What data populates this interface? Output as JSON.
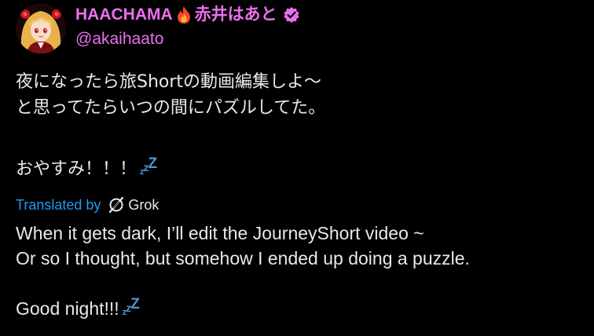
{
  "author": {
    "display_name_prefix": "HAACHAMA",
    "display_name_suffix": "赤井はあと",
    "handle": "@akaihaato",
    "name_color": "#eb6ff0",
    "icons": [
      "avatar",
      "fire-icon",
      "verified-badge-icon"
    ]
  },
  "post": {
    "lines": [
      "夜になったら旅Shortの動画編集しよ～",
      "と思ってたらいつの間にパズルしてた。"
    ],
    "closing": "おやすみ！！！",
    "sleep_emoji": "zzZ"
  },
  "translation": {
    "label": "Translated by",
    "provider": "Grok",
    "provider_icon": "grok-icon",
    "label_color": "#1d9bf0",
    "lines": [
      "When it gets dark, I’ll edit the JourneyShort video ~",
      "Or so I thought, but somehow I ended up doing a puzzle."
    ],
    "closing": "Good night!!!",
    "sleep_emoji": "zzZ"
  },
  "colors": {
    "background": "#000000",
    "text": "#e7e9ea",
    "zzz": "#4f93d6"
  }
}
